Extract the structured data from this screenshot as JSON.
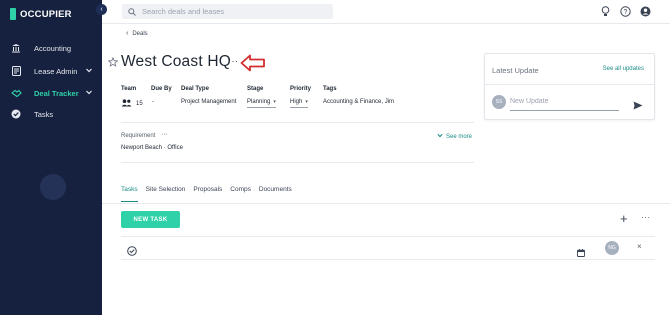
{
  "app": {
    "logo_text": "OCCUPIER"
  },
  "sidebar": {
    "items": [
      {
        "label": "Accounting",
        "icon": "bank-icon"
      },
      {
        "label": "Lease Admin",
        "icon": "document-icon"
      },
      {
        "label": "Deal Tracker",
        "icon": "handshake-icon",
        "active": true
      },
      {
        "label": "Tasks",
        "icon": "check-circle-icon"
      }
    ]
  },
  "topbar": {
    "search_placeholder": "Search deals and leases"
  },
  "breadcrumb": {
    "back_label": "Deals"
  },
  "deal": {
    "title": "West Coast HQ",
    "fields": {
      "team_label": "Team",
      "team_value": "15",
      "due_label": "Due By",
      "due_value": "-",
      "type_label": "Deal Type",
      "type_value": "Project Management",
      "stage_label": "Stage",
      "stage_value": "Planning",
      "priority_label": "Priority",
      "priority_value": "High",
      "tags_label": "Tags",
      "tags_value": "Accounting & Finance, Jim"
    },
    "requirement_label": "Requirement",
    "requirement_value": "Newport Beach · Office",
    "see_more": "See more"
  },
  "latest_update": {
    "title": "Latest Update",
    "see_all": "See all updates",
    "avatar": "SS",
    "placeholder": "New Update"
  },
  "tabs": [
    "Tasks",
    "Site Selection",
    "Proposals",
    "Comps",
    "Documents"
  ],
  "tasks": {
    "new_task_label": "NEW TASK",
    "row_avatar": "NG"
  },
  "colors": {
    "sidebar_bg": "#15213f",
    "accent": "#2fd1a9",
    "link": "#1d8c86",
    "annotation_arrow": "#d32f2f"
  }
}
